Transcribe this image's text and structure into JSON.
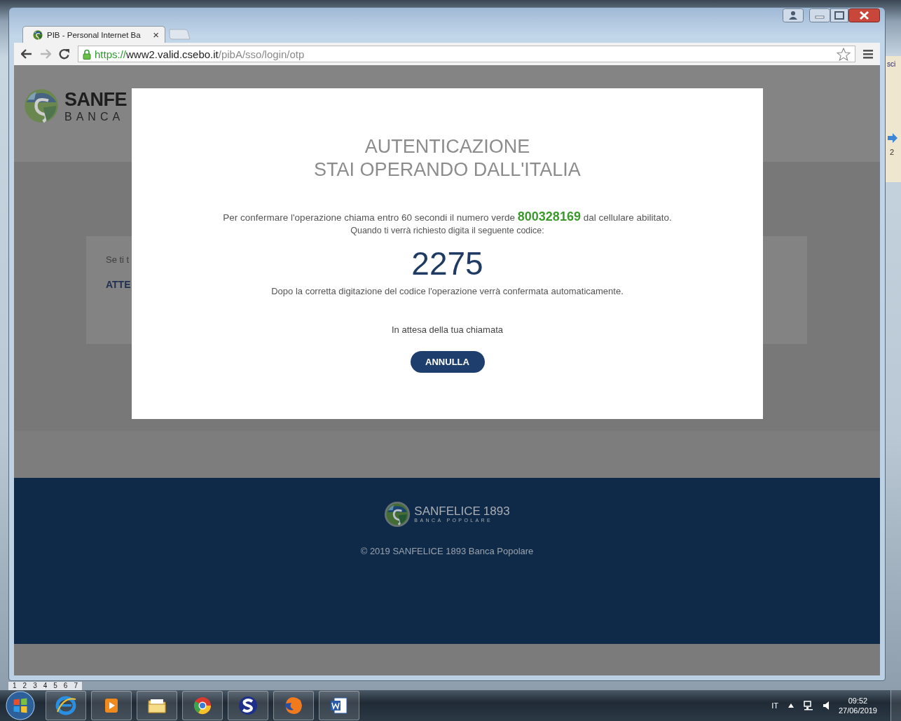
{
  "desktop": {
    "edge_texts": [
      "sci",
      "2"
    ],
    "page_numbers": [
      "1",
      "2",
      "3",
      "4",
      "5",
      "6",
      "7"
    ]
  },
  "browser": {
    "tabs": [
      {
        "title": "PIB - Personal Internet Ba",
        "selected": true,
        "close": "×"
      }
    ],
    "address": {
      "scheme": "https://",
      "host": "www2.valid.csebo.it",
      "path": "/pibA/sso/login/otp"
    }
  },
  "page": {
    "header": {
      "brand": "SANFE",
      "subtitle": "BANCA"
    },
    "card": {
      "line": "Se ti t",
      "heading": "ATTE"
    },
    "modal": {
      "title_lines": [
        "AUTENTICAZIONE",
        "STAI OPERANDO DALL'ITALIA"
      ],
      "message": "Per confermare l'operazione chiama entro 60 secondi il numero verde **800328169** dal cellulare abilitato.",
      "instruction": "Quando ti verrà richiesto digita il seguente codice:",
      "code": "2275",
      "note": "Dopo la corretta digitazione del codice l'operazione verrà confermata automaticamente.",
      "status": "In attesa della tua chiamata",
      "button": "ANNULLA"
    },
    "footer": {
      "brand": "SANFELICE",
      "year": "1893",
      "subtitle": "BANCA POPOLARE",
      "copyright": "© 2019 SANFELICE 1893 Banca Popolare"
    }
  },
  "taskbar": {
    "apps": [
      {
        "kind": "ie"
      },
      {
        "kind": "media"
      },
      {
        "kind": "folder"
      },
      {
        "kind": "chrome"
      },
      {
        "kind": "s"
      },
      {
        "kind": "firefox"
      },
      {
        "kind": "word"
      }
    ],
    "language": "IT",
    "time": "09:52",
    "date": "27/06/2019"
  }
}
